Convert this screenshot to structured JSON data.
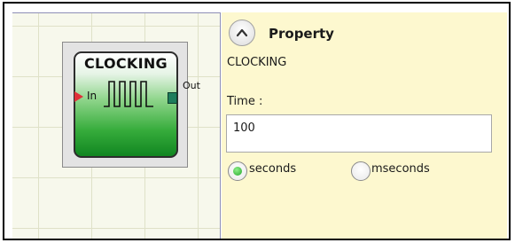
{
  "block": {
    "title": "CLOCKING",
    "input_label": "In",
    "output_label": "Out"
  },
  "property_panel": {
    "header": "Property",
    "subtitle": "CLOCKING",
    "time_label": "Time :",
    "time_value": "100",
    "units": [
      {
        "label": "seconds",
        "selected": true
      },
      {
        "label": "mseconds",
        "selected": false
      }
    ]
  },
  "icons": [
    "collapse-chevron-up-icon",
    "clock-pulse-icon",
    "input-arrow-icon",
    "output-pin-icon"
  ],
  "colors": {
    "block_green": "#36ac3b",
    "panel_background": "#fdf8cf",
    "input_pin": "#e0303a",
    "output_pin": "#1e7d5c"
  }
}
